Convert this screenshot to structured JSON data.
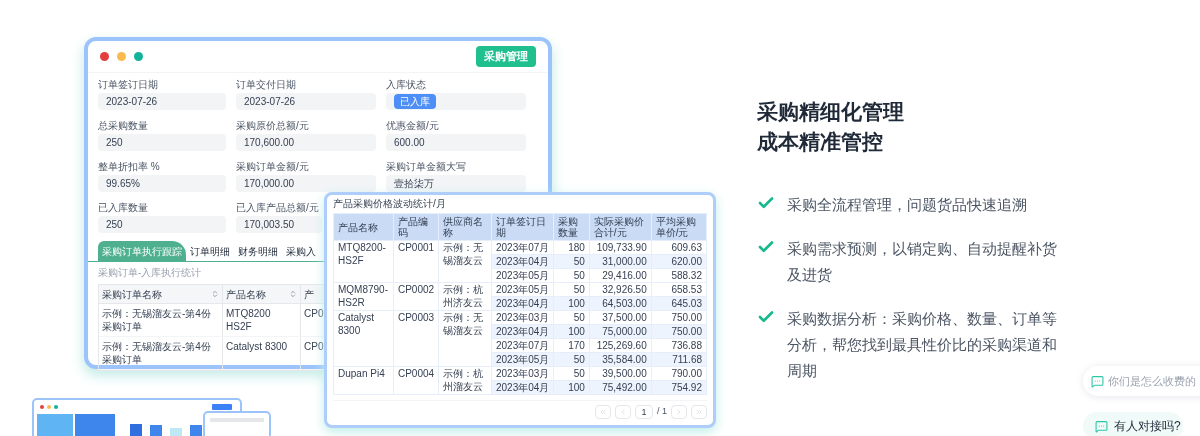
{
  "main_window": {
    "badge": "采购管理",
    "fields": [
      {
        "label": "订单签订日期",
        "value": "2023-07-26",
        "kind": "text"
      },
      {
        "label": "订单交付日期",
        "value": "2023-07-26",
        "kind": "text"
      },
      {
        "label": "入库状态",
        "value": "已入库",
        "kind": "tag"
      },
      {
        "label": "总采购数量",
        "value": "250",
        "kind": "text"
      },
      {
        "label": "采购原价总额/元",
        "value": "170,600.00",
        "kind": "text"
      },
      {
        "label": "优惠金额/元",
        "value": "600.00",
        "kind": "text"
      },
      {
        "label": "整单折扣率 %",
        "value": "99.65%",
        "kind": "text"
      },
      {
        "label": "采购订单金额/元",
        "value": "170,000.00",
        "kind": "text"
      },
      {
        "label": "采购订单金额大写",
        "value": "壹拾柒万",
        "kind": "text"
      },
      {
        "label": "已入库数量",
        "value": "250",
        "kind": "text"
      },
      {
        "label": "已入库产品总额/元",
        "value": "170,003.50",
        "kind": "text"
      }
    ],
    "tabs": [
      {
        "label": "采购订单执行跟踪",
        "selected": true
      },
      {
        "label": "订单明细",
        "selected": false
      },
      {
        "label": "财务明细",
        "selected": false
      },
      {
        "label": "采购入",
        "selected": false
      }
    ],
    "subtitle": "采购订单-入库执行统计",
    "order_table": {
      "columns": [
        {
          "label": "采购订单名称",
          "sortable": true
        },
        {
          "label": "产品名称",
          "sortable": true
        },
        {
          "label": "产",
          "sortable": false
        }
      ],
      "rows": [
        [
          "示例：无锡溜友云-第4份采购订单",
          "MTQ8200 HS2F",
          "CP0"
        ],
        [
          "示例：无锡溜友云-第4份采购订单",
          "Catalyst 8300",
          "CP0"
        ]
      ]
    }
  },
  "price_table": {
    "title": "产品采购价格波动统计/月",
    "columns": [
      "产品名称",
      "产品编码",
      "供应商名称",
      "订单签订日期",
      "采购数量",
      "实际采购价合计/元",
      "平均采购单价/元"
    ],
    "groups": [
      {
        "name": "MTQ8200-HS2F",
        "code": "CP0001",
        "supplier": "示例：无锡溜友云",
        "entries": [
          {
            "date": "2023年07月",
            "qty": "180",
            "total": "109,733.90",
            "avg": "609.63"
          },
          {
            "date": "2023年04月",
            "qty": "50",
            "total": "31,000.00",
            "avg": "620.00"
          },
          {
            "date": "2023年05月",
            "qty": "50",
            "total": "29,416.00",
            "avg": "588.32"
          }
        ]
      },
      {
        "name": "MQM8790-HS2R",
        "code": "CP0002",
        "supplier": "示例：杭州济友云",
        "entries": [
          {
            "date": "2023年05月",
            "qty": "50",
            "total": "32,926.50",
            "avg": "658.53"
          },
          {
            "date": "2023年04月",
            "qty": "100",
            "total": "64,503.00",
            "avg": "645.03"
          }
        ]
      },
      {
        "name": "Catalyst 8300",
        "code": "CP0003",
        "supplier": "示例：无锡溜友云",
        "entries": [
          {
            "date": "2023年03月",
            "qty": "50",
            "total": "37,500.00",
            "avg": "750.00"
          },
          {
            "date": "2023年04月",
            "qty": "100",
            "total": "75,000.00",
            "avg": "750.00"
          },
          {
            "date": "2023年07月",
            "qty": "170",
            "total": "125,269.60",
            "avg": "736.88"
          },
          {
            "date": "2023年05月",
            "qty": "50",
            "total": "35,584.00",
            "avg": "711.68"
          }
        ]
      },
      {
        "name": "Dupan Pi4",
        "code": "CP0004",
        "supplier": "示例：杭州溜友云",
        "entries": [
          {
            "date": "2023年03月",
            "qty": "50",
            "total": "39,500.00",
            "avg": "790.00"
          },
          {
            "date": "2023年04月",
            "qty": "100",
            "total": "75,492.00",
            "avg": "754.92"
          }
        ]
      }
    ],
    "pagination": {
      "page": "1",
      "total": "/ 1"
    }
  },
  "headline": [
    "采购精细化管理",
    "成本精准管控"
  ],
  "features": [
    "采购全流程管理，问题货品快速追溯",
    "采购需求预测，以销定购、自动提醒补货及进货",
    "采购数据分析：采购价格、数量、订单等分析，帮您找到最具性价比的采购渠道和周期"
  ],
  "chat": [
    "你们是怎么收费的",
    "有人对接吗?"
  ]
}
